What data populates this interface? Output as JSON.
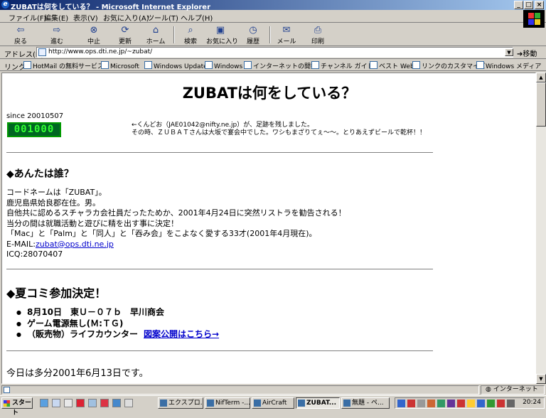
{
  "window": {
    "title": "ZUBATは何をしている？ - Microsoft Internet Explorer",
    "controls": [
      "_",
      "□",
      "×"
    ]
  },
  "menu": [
    "ファイル(F)",
    "編集(E)",
    "表示(V)",
    "お気に入り(A)",
    "ツール(T)",
    "ヘルプ(H)"
  ],
  "toolbar": {
    "back": "戻る",
    "forward": "進む",
    "stop": "中止",
    "refresh": "更新",
    "home": "ホーム",
    "search": "検索",
    "favorites": "お気に入り",
    "history": "履歴",
    "mail": "メール",
    "print": "印刷"
  },
  "address": {
    "label": "アドレス(D)",
    "url": "http://www.ops.dti.ne.jp/~zubat/",
    "go": "移動"
  },
  "links": {
    "label": "リンク",
    "items": [
      "HotMail の無料サービス",
      "Microsoft",
      "Windows Update",
      "Windows",
      "インターネットの開始",
      "チャンネル ガイド",
      "ベスト Web",
      "リンクのカスタマイズ",
      "Windows メディア"
    ]
  },
  "page": {
    "heading": "ZUBATは何をしている？",
    "since": "since 20010507",
    "counter": "001000",
    "footprint": [
      "←くんどお（JAE01042@nifty.ne.jp）が、足跡を残しました。",
      "その時、ＺＵＢＡＴさんは大坂で宴会中でした。ワシもまざりてぇ〜〜。とりあえずビールで乾杯！！"
    ],
    "who_heading": "◆あんたは誰？",
    "profile": [
      "コードネームは「ZUBAT」。",
      "鹿児島県姶良郡在住。男。",
      "自他共に認めるスチャラカ会社員だったためか、2001年4月24日に突然リストラを勧告される！",
      "当分の間は就職活動と遊びに精を出す事に決定！",
      "「Mac」と「Palm」と「同人」と「吞み会」をこよなく愛する33才(2001年4月現在)。"
    ],
    "email_label": "E-MAIL:",
    "email": "zubat@ops.dti.ne.jp",
    "icq": "ICQ:28070407",
    "comike_heading": "◆夏コミ参加決定！",
    "booth_items": [
      "8月10日　東Ｕ－０７ｂ　早川商会",
      "ゲーム電源無し(Ｍ:ＴＧ)",
      "（販売物）ライフカウンター"
    ],
    "booth_link": "図案公開はこちら→",
    "today": "今日は多分2001年6月13日です。"
  },
  "status": {
    "zone": "インターネット"
  },
  "taskbar": {
    "start": "スタート",
    "tasks": [
      "エクスプロ...",
      "NifTerm -...",
      "AirCraft",
      "ZUBAT...",
      "無題 - ペ..."
    ],
    "clock": "20:24"
  }
}
